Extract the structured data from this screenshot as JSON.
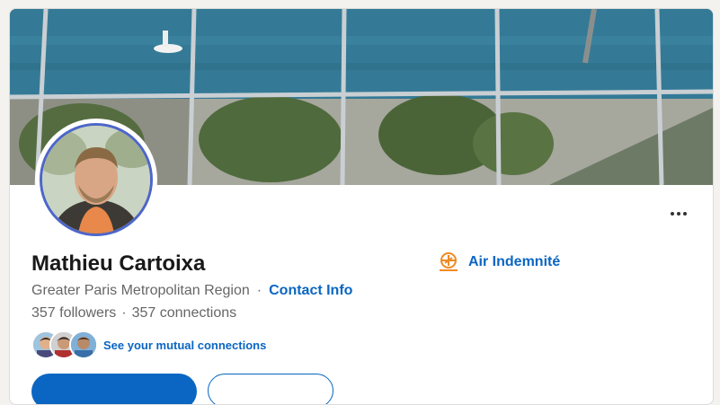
{
  "profile": {
    "name": "Mathieu Cartoixa",
    "location": "Greater Paris Metropolitan Region",
    "separator": "·",
    "contact_info": "Contact Info",
    "followers": "357 followers",
    "connections": "357 connections",
    "mutual_connections_link": "See your mutual connections"
  },
  "company": {
    "name": "Air Indemnité",
    "logo_icon": "air-indemnite-logo"
  },
  "actions": {
    "more_icon": "more-horizontal-icon",
    "primary_button_label": "",
    "secondary_button_label": ""
  },
  "colors": {
    "link_blue": "#0a66c2",
    "avatar_ring": "#4d66c9",
    "text_primary": "#191919",
    "text_secondary": "#666666"
  }
}
